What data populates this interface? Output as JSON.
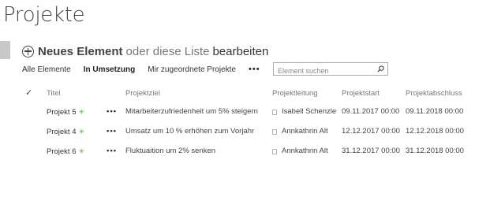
{
  "page": {
    "title": "Projekte"
  },
  "toolbar": {
    "new_item": "Neues Element",
    "middle_text": "oder diese Liste",
    "edit_link": "bearbeiten"
  },
  "views": {
    "all_items": "Alle Elemente",
    "in_progress": "In Umsetzung",
    "assigned": "Mir zugeordnete Projekte",
    "more": "•••"
  },
  "search": {
    "placeholder": "Element suchen",
    "icon": "search-icon"
  },
  "table": {
    "check_symbol": "✓",
    "headers": {
      "titel": "Titel",
      "projektziel": "Projektziel",
      "projektleitung": "Projektleitung",
      "projektstart": "Projektstart",
      "projektabschluss": "Projektabschluss"
    },
    "new_badge": "✳",
    "menu_label": "•••",
    "rows": [
      {
        "titel": "Projekt 5",
        "projektziel": "Mitarbeiterzufriedenheit um 5% steigern",
        "projektleitung": "Isabell Schenzle",
        "projektstart": "09.11.2017 00:00",
        "projektabschluss": "09.11.2018 00:00"
      },
      {
        "titel": "Projekt 4",
        "projektziel": "Umsatz um 10 % erhöhen zum Vorjahr",
        "projektleitung": "Annkathrin Alt",
        "projektstart": "12.12.2017 00:00",
        "projektabschluss": "12.12.2018 00:00"
      },
      {
        "titel": "Projekt 6",
        "projektziel": "Fluktuaition um 2% senken",
        "projektleitung": "Annkathrin Alt",
        "projektstart": "31.12.2017 00:00",
        "projektabschluss": "31.12.2018 00:00"
      }
    ]
  },
  "colors": {
    "new_badge": "#5fae3c",
    "left_bar": "#c8c8c8"
  }
}
